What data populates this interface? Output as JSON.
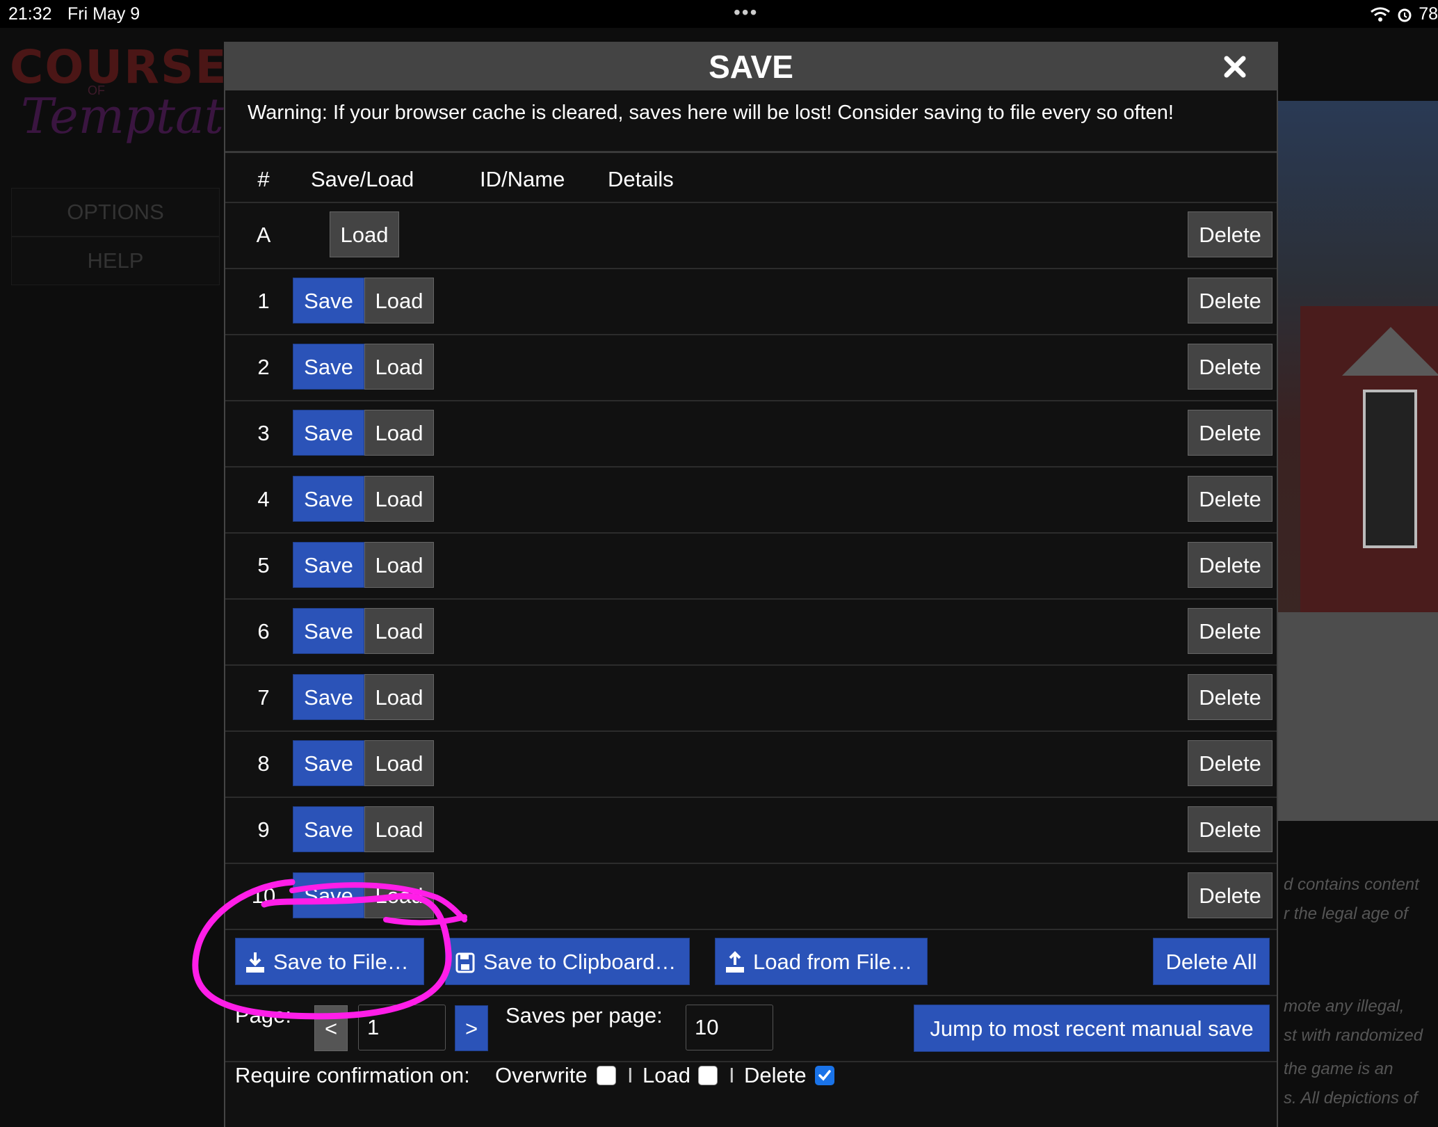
{
  "status_bar": {
    "time": "21:32",
    "date": "Fri May 9",
    "battery": "78"
  },
  "background": {
    "logo": {
      "word1": "COURSE",
      "word2": "OF",
      "word3": "Temptation"
    },
    "menu": [
      "OPTIONS",
      "HELP"
    ],
    "notice_lines": [
      "d contains content",
      "r the legal age of",
      "mote any illegal,",
      "st with randomized",
      "the game is an",
      "s. All depictions of"
    ]
  },
  "dialog": {
    "title": "SAVE",
    "warning": "Warning: If your browser cache is cleared, saves here will be lost! Consider saving to file every so often!",
    "columns": [
      "#",
      "Save/Load",
      "ID/Name",
      "Details"
    ],
    "auto_row": {
      "label": "A",
      "load": "Load",
      "delete": "Delete"
    },
    "rows": [
      {
        "label": "1",
        "save": "Save",
        "load": "Load",
        "delete": "Delete"
      },
      {
        "label": "2",
        "save": "Save",
        "load": "Load",
        "delete": "Delete"
      },
      {
        "label": "3",
        "save": "Save",
        "load": "Load",
        "delete": "Delete"
      },
      {
        "label": "4",
        "save": "Save",
        "load": "Load",
        "delete": "Delete"
      },
      {
        "label": "5",
        "save": "Save",
        "load": "Load",
        "delete": "Delete"
      },
      {
        "label": "6",
        "save": "Save",
        "load": "Load",
        "delete": "Delete"
      },
      {
        "label": "7",
        "save": "Save",
        "load": "Load",
        "delete": "Delete"
      },
      {
        "label": "8",
        "save": "Save",
        "load": "Load",
        "delete": "Delete"
      },
      {
        "label": "9",
        "save": "Save",
        "load": "Load",
        "delete": "Delete"
      },
      {
        "label": "10",
        "save": "Save",
        "load": "Load",
        "delete": "Delete"
      }
    ],
    "file_actions": {
      "save_to_file": "Save to File…",
      "save_to_clipboard": "Save to Clipboard…",
      "load_from_file": "Load from File…",
      "delete_all": "Delete All"
    },
    "paging": {
      "page_label": "Page:",
      "prev": "<",
      "page_value": "1",
      "next": ">",
      "per_page_label": "Saves per page:",
      "per_page_value": "10",
      "jump": "Jump to most recent manual save"
    },
    "confirmation": {
      "label": "Require confirmation on:",
      "overwrite": "Overwrite",
      "overwrite_checked": false,
      "load": "Load",
      "load_checked": false,
      "delete": "Delete",
      "delete_checked": true,
      "separator": "I"
    }
  },
  "colors": {
    "accent_blue": "#2b53b8",
    "annotation": "#ff1ee8",
    "checkbox_on": "#1a73e8"
  }
}
